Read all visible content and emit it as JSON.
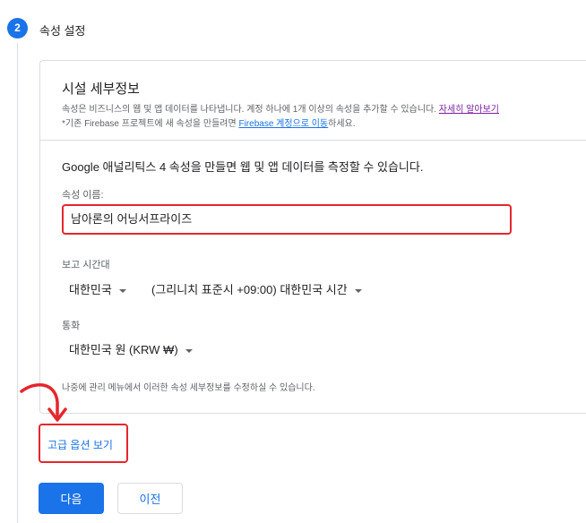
{
  "step": {
    "number": "2",
    "title": "속성 설정"
  },
  "details": {
    "title": "시설 세부정보",
    "desc1": "속성은 비즈니스의 웹 및 앱 데이터를 나타냅니다. 계정 하나에 1개 이상의 속성을 추가할 수 있습니다. ",
    "desc1_link": "자세히 알아보기",
    "desc2_prefix": "*기존 Firebase 프로젝트에 새 속성을 만들려면 ",
    "desc2_link": "Firebase 계정으로 이동",
    "desc2_suffix": "하세요."
  },
  "form": {
    "intro": "Google 애널리틱스 4 속성을 만들면 웹 및 앱 데이터를 측정할 수 있습니다.",
    "property_name_label": "속성 이름:",
    "property_name_value": "남아론의 어닝서프라이즈",
    "timezone_label": "보고 시간대",
    "country_value": "대한민국",
    "timezone_value": "(그리니치 표준시 +09:00) 대한민국 시간",
    "currency_label": "통화",
    "currency_value": "대한민국 원 (KRW ₩)",
    "helper": "나중에 관리 메뉴에서 이러한 속성 세부정보를 수정하실 수 있습니다."
  },
  "advanced_link": "고급 옵션 보기",
  "buttons": {
    "next": "다음",
    "back": "이전"
  },
  "colors": {
    "accent": "#1a73e8",
    "highlight": "#e5262d",
    "visited_link": "#7b1fa2"
  },
  "icons": [
    "curved-arrow-icon",
    "chevron-down-icon"
  ]
}
